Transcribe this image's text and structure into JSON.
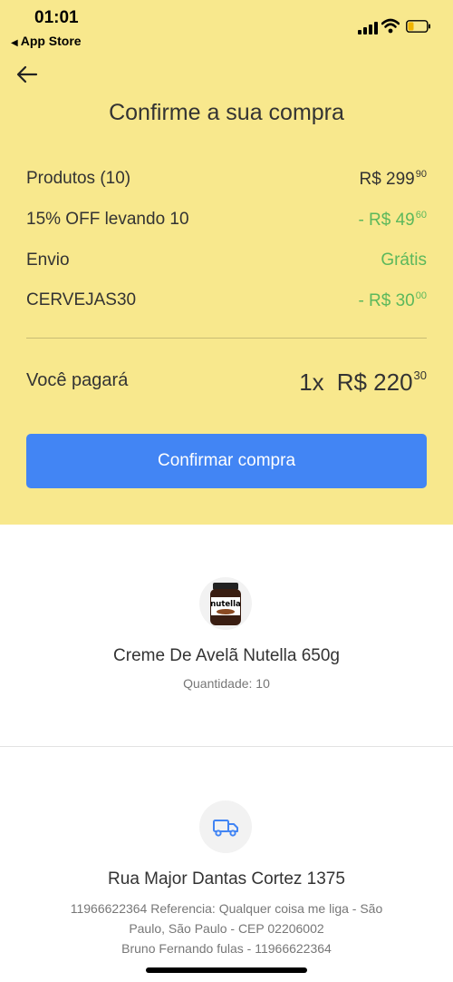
{
  "status_bar": {
    "time": "01:01",
    "back_app": "App Store"
  },
  "header": {
    "title": "Confirme a sua compra"
  },
  "summary": {
    "products": {
      "label": "Produtos (10)",
      "value": "R$ 299",
      "cents": "90"
    },
    "discount": {
      "label": "15% OFF levando 10",
      "value": "- R$ 49",
      "cents": "60"
    },
    "shipping": {
      "label": "Envio",
      "value": "Grátis"
    },
    "coupon": {
      "label": "CERVEJAS30",
      "value": "- R$ 30",
      "cents": "00"
    }
  },
  "total": {
    "label": "Você pagará",
    "installments": "1x",
    "value": "R$ 220",
    "cents": "30"
  },
  "confirm_button": {
    "label": "Confirmar compra"
  },
  "product": {
    "name": "Creme De Avelã Nutella 650g",
    "quantity": "Quantidade: 10",
    "image_brand": "nutella"
  },
  "address": {
    "street": "Rua Major Dantas Cortez 1375",
    "line1": "11966622364 Referencia: Qualquer coisa me liga - São",
    "line2": "Paulo, São Paulo - CEP 02206002",
    "line3": "Bruno Fernando fulas - 11966622364"
  },
  "colors": {
    "header_bg": "#f8e88d",
    "accent_blue": "#4285f4",
    "green_discount": "#5cb85c"
  },
  "icons": [
    "back-arrow-icon",
    "signal-icon",
    "wifi-icon",
    "battery-icon",
    "truck-icon"
  ]
}
